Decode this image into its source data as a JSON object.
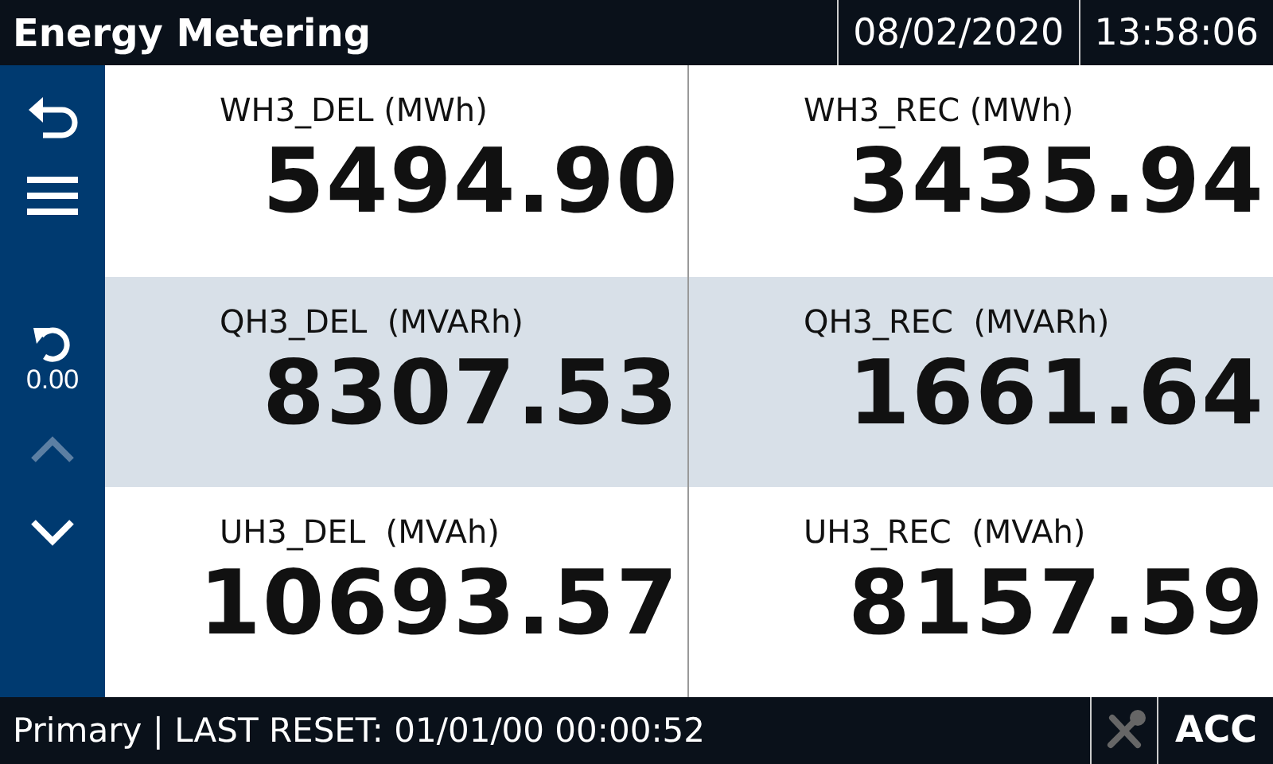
{
  "header": {
    "title": "Energy Metering",
    "date": "08/02/2020",
    "time": "13:58:06"
  },
  "sidebar": {
    "reset_value": "0.00",
    "scroll_up": {
      "disabled": true
    },
    "scroll_down": {
      "disabled": false
    }
  },
  "readings": [
    {
      "label": "WH3_DEL (MWh)",
      "value": "5494.90",
      "shaded": false
    },
    {
      "label": "WH3_REC (MWh)",
      "value": "3435.94",
      "shaded": false
    },
    {
      "label": "QH3_DEL  (MVARh)",
      "value": "8307.53",
      "shaded": true
    },
    {
      "label": "QH3_REC  (MVARh)",
      "value": "1661.64",
      "shaded": true
    },
    {
      "label": "UH3_DEL  (MVAh)",
      "value": "10693.57",
      "shaded": false
    },
    {
      "label": "UH3_REC  (MVAh)",
      "value": "8157.59",
      "shaded": false
    }
  ],
  "status_bar": {
    "text": "Primary | LAST RESET: 01/01/00 00:00:52",
    "tools": {
      "disabled": true
    },
    "mode": "ACC"
  }
}
